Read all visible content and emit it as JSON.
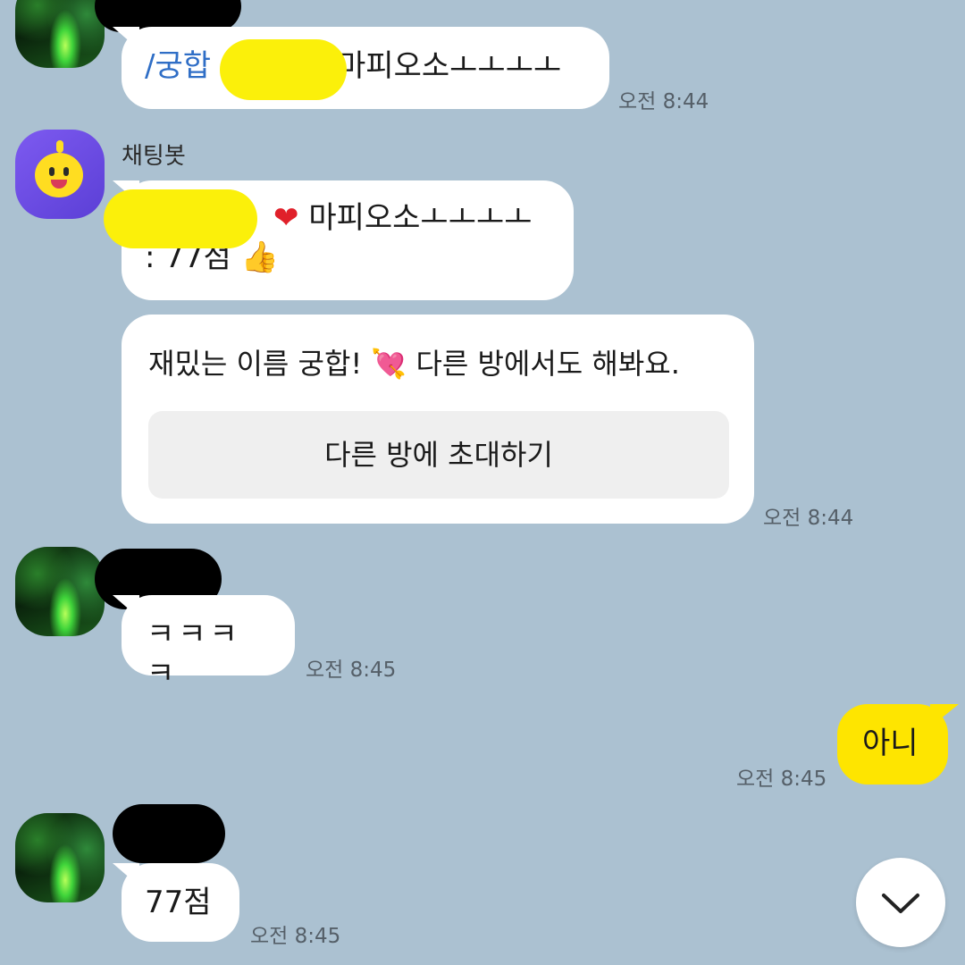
{
  "messages": {
    "m1": {
      "command": "/궁합",
      "text": "마피오소ㅗㅗㅗㅗ",
      "time": "오전 8:44"
    },
    "bot": {
      "sender": "채팅봇",
      "heart": "❤",
      "result_text": "마피오소ㅗㅗㅗㅗ",
      "score": ": 77점",
      "thumb": "👍",
      "card_text": "재밌는 이름 궁합! 💘 다른 방에서도 해봐요.",
      "card_button": "다른 방에 초대하기",
      "time": "오전 8:44"
    },
    "m2": {
      "text": "ㅋㅋㅋㅋ",
      "time": "오전 8:45"
    },
    "me": {
      "text": "아니",
      "time": "오전 8:45"
    },
    "m3": {
      "text": "77점",
      "time": "오전 8:45"
    }
  },
  "icons": {
    "scroll_down": "chevron-down-icon",
    "bot_avatar": "chatbot-avatar"
  },
  "colors": {
    "background": "#abc1d1",
    "my_bubble": "#fee500",
    "other_bubble": "#ffffff",
    "command_text": "#2f6ec6",
    "redaction_yellow": "#fbf00a"
  }
}
